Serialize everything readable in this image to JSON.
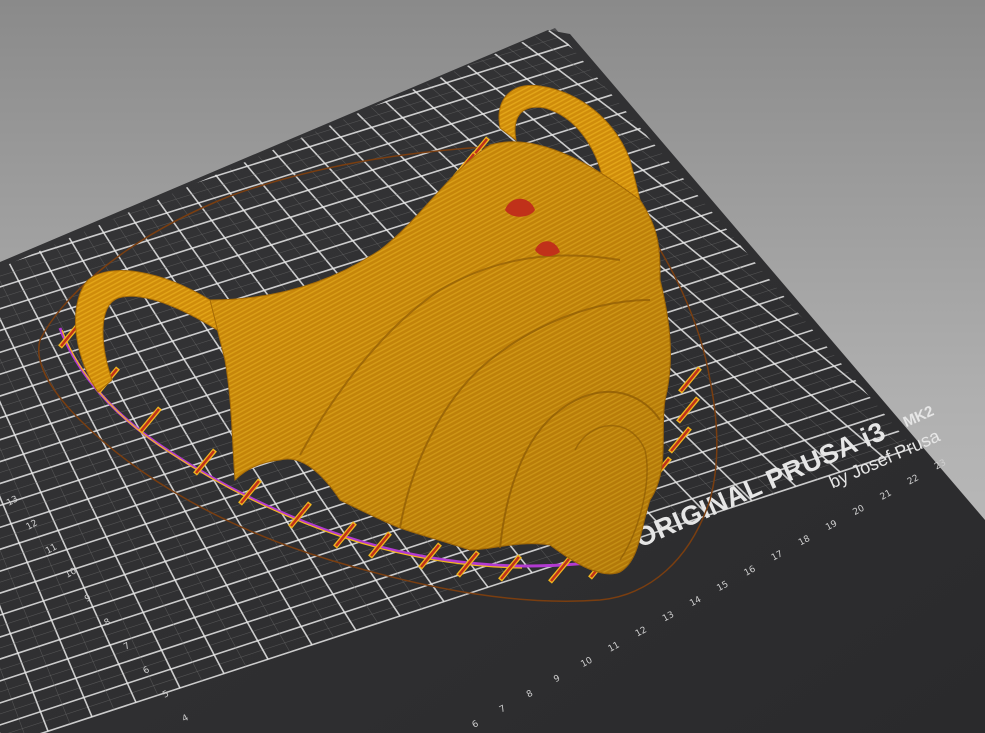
{
  "bed": {
    "brand_line": "ORIGINAL PRUSA i3",
    "model_suffix": "MK2",
    "byline": "by Josef Prusa",
    "x_ticks": [
      "6",
      "7",
      "8",
      "9",
      "10",
      "11",
      "12",
      "13",
      "14",
      "15",
      "16",
      "17",
      "18",
      "19",
      "20",
      "21",
      "22",
      "23"
    ],
    "y_ticks": [
      "4",
      "5",
      "6",
      "7",
      "8",
      "9",
      "10",
      "11",
      "12",
      "13"
    ]
  },
  "colors": {
    "bed_plate": "#2e2e30",
    "grid_major": "#e8e8e8",
    "grid_minor": "#6a6a6a",
    "print_body": "#d18f0a",
    "perimeter_highlight": "#f2b61e",
    "support_red": "#c0311a",
    "purple_line": "#b23ad0",
    "skirt_brown": "#7a3e10"
  }
}
